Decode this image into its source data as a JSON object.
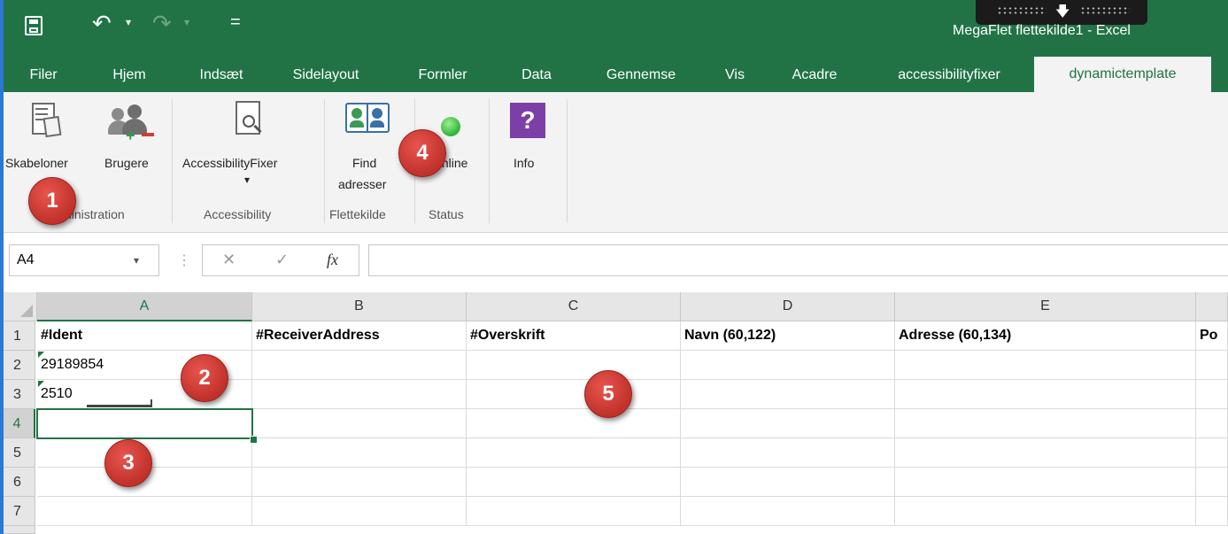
{
  "titlebar": {
    "title": "MegaFlet flettekilde1 - Excel",
    "undo_glyph": "↶",
    "redo_glyph": "↷",
    "qat_more": "="
  },
  "tabs": [
    {
      "label": "Filer"
    },
    {
      "label": "Hjem"
    },
    {
      "label": "Indsæt"
    },
    {
      "label": "Sidelayout"
    },
    {
      "label": "Formler"
    },
    {
      "label": "Data"
    },
    {
      "label": "Gennemse"
    },
    {
      "label": "Vis"
    },
    {
      "label": "Acadre"
    },
    {
      "label": "accessibilityfixer"
    },
    {
      "label": "dynamictemplate"
    }
  ],
  "ribbon": {
    "skabeloner": "Skabeloner",
    "brugere": "Brugere",
    "accessibilityfixer": "AccessibilityFixer",
    "dropdown_arrow": "▾",
    "find_line1": "Find",
    "find_line2": "adresser",
    "online": "Online",
    "info": "Info",
    "info_glyph": "?",
    "groups": {
      "administration": "Administration",
      "accessibility": "Accessibility",
      "flettekilde": "Flettekilde",
      "status": "Status"
    }
  },
  "formula_bar": {
    "name_box": "A4",
    "cancel": "✕",
    "enter": "✓",
    "fx": "fx",
    "value": ""
  },
  "sheet": {
    "columns": [
      "A",
      "B",
      "C",
      "D",
      "E"
    ],
    "rows": [
      "1",
      "2",
      "3",
      "4",
      "5",
      "6",
      "7"
    ],
    "headers": {
      "a": "#Ident",
      "b": "#ReceiverAddress",
      "c": "#Overskrift",
      "d": "Navn (60,122)",
      "e": "Adresse (60,134)",
      "f": "Po"
    },
    "r2a": "29189854",
    "r3a": "2510"
  },
  "callouts": [
    "1",
    "2",
    "3",
    "4",
    "5"
  ],
  "colors": {
    "excel_green": "#217346",
    "callout_red": "#d0403a",
    "ribbon_bg": "#f3f3f3"
  }
}
